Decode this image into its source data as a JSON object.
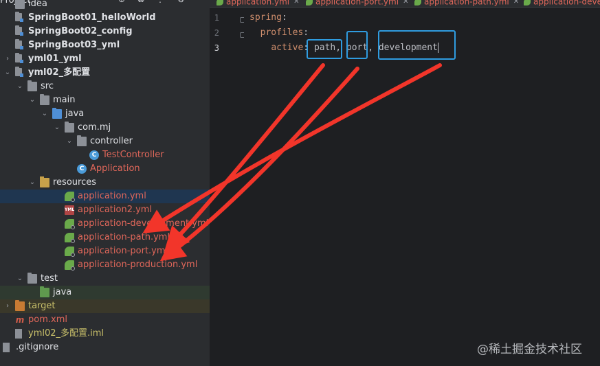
{
  "sidebar": {
    "header": {
      "title": "Project"
    },
    "tree": [
      {
        "label": "idea",
        "indent": 0,
        "icon": "folder-icon",
        "color": "normal",
        "arrow": "",
        "style": "normal"
      },
      {
        "label": "SpringBoot01_helloWorld",
        "indent": 0,
        "icon": "module-icon",
        "color": "normal",
        "arrow": "",
        "style": "bold"
      },
      {
        "label": "SpringBoot02_config",
        "indent": 0,
        "icon": "module-icon",
        "color": "normal",
        "arrow": "",
        "style": "bold"
      },
      {
        "label": "SpringBoot03_yml",
        "indent": 0,
        "icon": "module-icon",
        "color": "normal",
        "arrow": "",
        "style": "bold"
      },
      {
        "label": "yml01_yml",
        "indent": 0,
        "icon": "module-icon",
        "color": "normal",
        "arrow": "right",
        "style": "bold"
      },
      {
        "label": "yml02_多配置",
        "indent": 0,
        "icon": "module-icon",
        "color": "normal",
        "arrow": "down",
        "style": "bold"
      },
      {
        "label": "src",
        "indent": 1,
        "icon": "folder-icon",
        "color": "normal",
        "arrow": "down",
        "style": "normal"
      },
      {
        "label": "main",
        "indent": 2,
        "icon": "folder-icon",
        "color": "normal",
        "arrow": "down",
        "style": "normal"
      },
      {
        "label": "java",
        "indent": 3,
        "icon": "source-folder-icon",
        "color": "normal",
        "arrow": "down",
        "style": "normal"
      },
      {
        "label": "com.mj",
        "indent": 4,
        "icon": "package-icon",
        "color": "normal",
        "arrow": "down",
        "style": "normal"
      },
      {
        "label": "controller",
        "indent": 5,
        "icon": "package-icon",
        "color": "normal",
        "arrow": "down",
        "style": "normal"
      },
      {
        "label": "TestController",
        "indent": 6,
        "icon": "java-class-icon",
        "color": "red",
        "arrow": "",
        "style": "normal"
      },
      {
        "label": "Application",
        "indent": 5,
        "icon": "spring-app-icon",
        "color": "red",
        "arrow": "",
        "style": "normal"
      },
      {
        "label": "resources",
        "indent": 2,
        "icon": "resources-folder-icon",
        "color": "normal",
        "arrow": "down",
        "style": "normal"
      },
      {
        "label": "application.yml",
        "indent": 4,
        "icon": "spring-yml-icon",
        "color": "red",
        "arrow": "",
        "style": "normal",
        "selected": true
      },
      {
        "label": "application2.yml",
        "indent": 4,
        "icon": "yml-file-icon",
        "color": "red",
        "arrow": "",
        "style": "normal"
      },
      {
        "label": "application-development.yml",
        "indent": 4,
        "icon": "spring-yml-icon",
        "color": "red",
        "arrow": "",
        "style": "normal"
      },
      {
        "label": "application-path.yml",
        "indent": 4,
        "icon": "spring-yml-icon",
        "color": "red",
        "arrow": "",
        "style": "normal"
      },
      {
        "label": "application-port.yml",
        "indent": 4,
        "icon": "spring-yml-icon",
        "color": "red",
        "arrow": "",
        "style": "normal"
      },
      {
        "label": "application-production.yml",
        "indent": 4,
        "icon": "spring-yml-icon",
        "color": "red",
        "arrow": "",
        "style": "normal"
      },
      {
        "label": "test",
        "indent": 1,
        "icon": "folder-icon",
        "color": "normal",
        "arrow": "down",
        "style": "normal"
      },
      {
        "label": "java",
        "indent": 2,
        "icon": "test-folder-icon",
        "color": "normal",
        "arrow": "",
        "style": "normal",
        "band": "green"
      },
      {
        "label": "target",
        "indent": 0,
        "icon": "excluded-folder-icon",
        "color": "yellow",
        "arrow": "right",
        "style": "normal",
        "band": "yellow"
      },
      {
        "label": "pom.xml",
        "indent": 0,
        "icon": "maven-icon",
        "color": "red",
        "arrow": "",
        "style": "normal"
      },
      {
        "label": "yml02_多配置.iml",
        "indent": 0,
        "icon": "iml-file-icon",
        "color": "yellow",
        "arrow": "",
        "style": "normal"
      },
      {
        "label": ".gitignore",
        "indent": -1,
        "icon": "text-file-icon",
        "color": "normal",
        "arrow": "",
        "style": "normal"
      }
    ]
  },
  "tabs": [
    {
      "label": "application.yml",
      "active": true
    },
    {
      "label": "application-port.yml",
      "active": false
    },
    {
      "label": "application-path.yml",
      "active": false
    },
    {
      "label": "application-development.yml",
      "active": false
    }
  ],
  "editor": {
    "lines": [
      {
        "number": "1",
        "indent": "",
        "key": "spring",
        "sep": ":",
        "value": ""
      },
      {
        "number": "2",
        "indent": "  ",
        "key": "profiles",
        "sep": ":",
        "value": ""
      },
      {
        "number": "3",
        "indent": "    ",
        "key": "active",
        "sep": ": ",
        "value": "path, port, development"
      }
    ],
    "profiles": [
      "path",
      "port",
      "development"
    ]
  },
  "watermark": "@稀土掘金技术社区",
  "colors": {
    "annotation_box": "#2f9ce0",
    "annotation_arrow": "#f2352a",
    "file_red": "#e0675a",
    "key_orange": "#cf8e6d"
  }
}
